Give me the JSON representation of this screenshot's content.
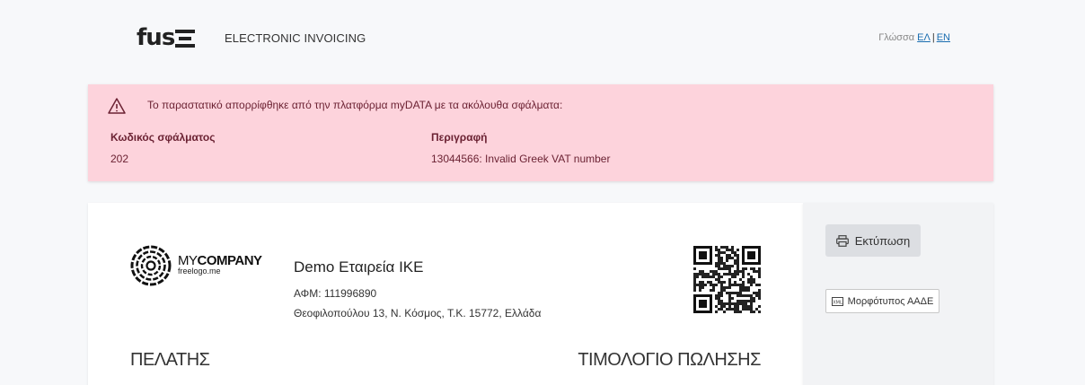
{
  "header": {
    "logo_text": "fus",
    "app_title": "ELECTRONIC INVOICING",
    "language_label": "Γλώσσα",
    "languages": [
      "ΕΛ",
      "EN"
    ]
  },
  "alert": {
    "message": "Το παραστατικό απορρίφθηκε από την πλατφόρμα myDATA με τα ακόλουθα σφάλματα:",
    "columns": [
      "Κωδικός σφάλματος",
      "Περιγραφή"
    ],
    "rows": [
      {
        "code": "202",
        "description": "13044566: Invalid Greek VAT number"
      }
    ],
    "colors": {
      "background": "#fdd3dc",
      "text": "#6b2233"
    }
  },
  "invoice": {
    "company_logo": {
      "name_light": "MY",
      "name_bold": "COMPANY",
      "sub": "freelogo.me"
    },
    "issuer_name": "Demo Εταιρεία ΙΚΕ",
    "vat": "ΑΦΜ: 111996890",
    "address": "Θεοφιλοπούλου 13, Ν. Κόσμος, Τ.Κ. 15772, Ελλάδα",
    "customer_heading": "ΠΕΛΑΤΗΣ",
    "document_type": "ΤΙΜΟΛΟΓΙΟ ΠΩΛΗΣΗΣ"
  },
  "actions": {
    "print_label": "Εκτύπωση",
    "aade_label": "Μορφότυπος ΑΑΔΕ",
    "aade_icon_text": "XML"
  }
}
